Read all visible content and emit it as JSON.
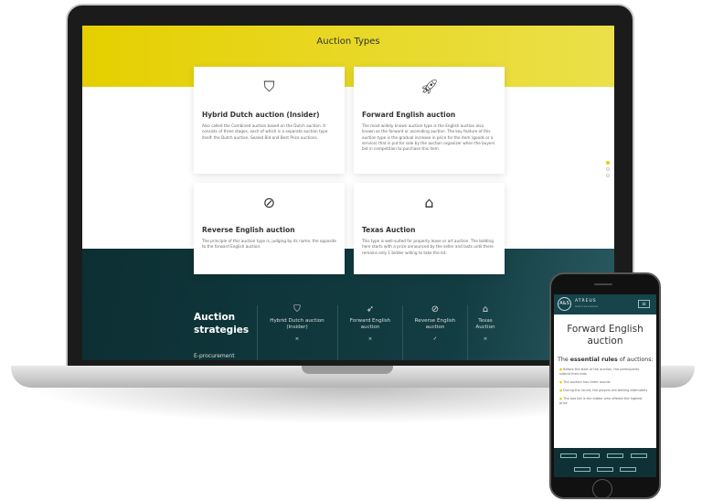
{
  "laptop": {
    "title": "Auction Types",
    "cards": [
      {
        "icon": "shield-icon",
        "title": "Hybrid Dutch auction (Insider)",
        "text": "Also called the Combined auction based on the Dutch auction. It consists of three stages, each of which is a separate auction type itself: the Dutch auction, Sealed Bid and Best Price auctions."
      },
      {
        "icon": "rocket-icon",
        "title": "Forward English auction",
        "text": "The most widely known auction type is the English auction also known as the forward or ascending auction. The key feature of this auction type is the gradual increase in price for the item (goods or a service) that is put for sale by the auction organizer when the buyers bid in competition to purchase this item."
      },
      {
        "icon": "falling-rocket-icon",
        "title": "Reverse English auction",
        "text": "The principle of this auction type is, judging by its name, the opposite to the forward English auction."
      },
      {
        "icon": "capsule-icon",
        "title": "Texas Auction",
        "text": "This type is well-suited for property lease or art auction. The bidding here starts with a price announced by the seller and lasts until there remains only 1 bidder willing to take the lot."
      }
    ],
    "strategies": {
      "title": "Auction strategies",
      "row_label": "E-procurement",
      "columns": [
        {
          "label": "Hybrid Dutch auction (Insider)",
          "mark": "×"
        },
        {
          "label": "Forward English auction",
          "mark": "×"
        },
        {
          "label": "Reverse English auction",
          "mark": "✓"
        },
        {
          "label": "Texas Auction",
          "mark": "×"
        }
      ]
    }
  },
  "phone": {
    "logo": "A&S",
    "brand": "ATREUS",
    "brand_sub": "auction as a service",
    "heading": "Forward English auction",
    "rules_title_pre": "The ",
    "rules_title_bold": "essential rules",
    "rules_title_post": " of auctions:",
    "rules": [
      "Before the start of the auction, the participants submit their bids",
      "The auction has three rounds",
      "During the round, the players are betting alternately",
      "The last bid is the bidder who offered the highest price"
    ],
    "accent": "#e5cf00"
  }
}
